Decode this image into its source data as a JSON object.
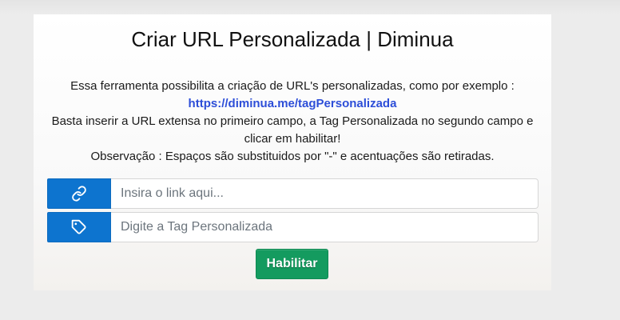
{
  "header": {
    "title": "Criar URL Personalizada | Diminua"
  },
  "description": {
    "line1": "Essa ferramenta possibilita a criação de URL's personalizadas, como por exemplo :",
    "example_link": "https://diminua.me/tagPersonalizada",
    "line2a": "Basta inserir a URL extensa no primeiro campo, a Tag Personalizada no segundo campo e",
    "line2b": "clicar em habilitar!",
    "note": "Observação : Espaços são substituidos por \"-\" e acentuações são retiradas."
  },
  "form": {
    "url_field": {
      "icon": "link-icon",
      "value": "",
      "placeholder": "Insira o link aqui..."
    },
    "tag_field": {
      "icon": "tag-icon",
      "value": "",
      "placeholder": "Digite a Tag Personalizada"
    },
    "submit_label": "Habilitar"
  },
  "colors": {
    "addon_blue": "#0d74cf",
    "button_green": "#149b5f",
    "link_blue": "#2d4ed8"
  }
}
